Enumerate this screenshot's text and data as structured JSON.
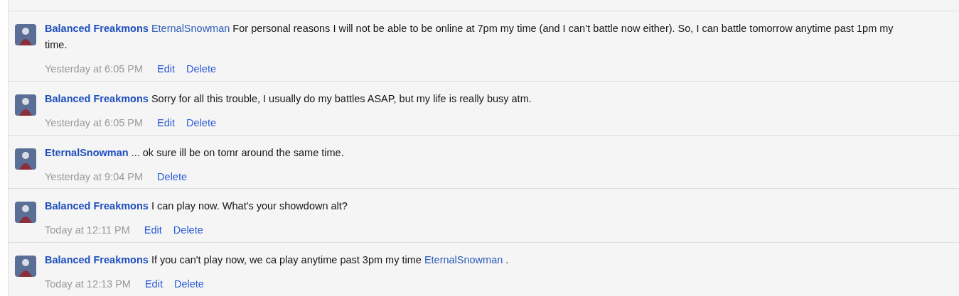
{
  "messages": [
    {
      "author": "Balanced Freakmons",
      "body": [
        {
          "kind": "mention",
          "text": "EternalSnowman"
        },
        {
          "kind": "text",
          "text": "For personal reasons I will not be able to be online at 7pm my time (and I can’t battle now either). So, I can battle tomorrow anytime past 1pm my time."
        }
      ],
      "time": "Yesterday at 6:05 PM",
      "actions": [
        "Edit",
        "Delete"
      ]
    },
    {
      "author": "Balanced Freakmons",
      "body": [
        {
          "kind": "text",
          "text": "Sorry for all this trouble, I usually do my battles ASAP, but my life is really busy atm."
        }
      ],
      "time": "Yesterday at 6:05 PM",
      "actions": [
        "Edit",
        "Delete"
      ]
    },
    {
      "author": "EternalSnowman",
      "body": [
        {
          "kind": "text",
          "text": "... ok sure ill be on tomr around the same time."
        }
      ],
      "time": "Yesterday at 9:04 PM",
      "actions": [
        "Delete"
      ]
    },
    {
      "author": "Balanced Freakmons",
      "body": [
        {
          "kind": "text",
          "text": "I can play now. What's your showdown alt?"
        }
      ],
      "time": "Today at 12:11 PM",
      "actions": [
        "Edit",
        "Delete"
      ]
    },
    {
      "author": "Balanced Freakmons",
      "body": [
        {
          "kind": "text",
          "text": "If you can't play now, we ca play anytime past 3pm my time"
        },
        {
          "kind": "mention",
          "text": "EternalSnowman"
        },
        {
          "kind": "text",
          "text": "."
        }
      ],
      "time": "Today at 12:13 PM",
      "actions": [
        "Edit",
        "Delete"
      ]
    }
  ]
}
